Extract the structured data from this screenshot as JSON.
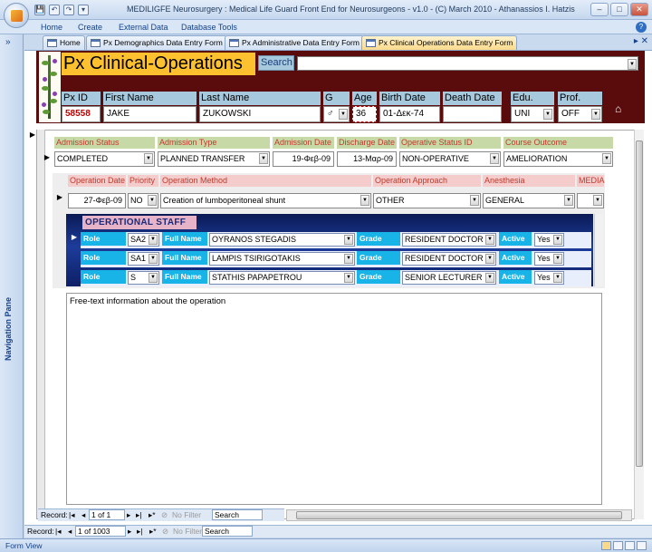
{
  "app": {
    "title": "MEDILIGFE Neurosurgery : Medical Life Guard Front End for Neurosurgeons - v1.0 - (C) March 2010 - Athanassios I. Hatzis",
    "window_buttons": [
      "–",
      "□",
      "✕"
    ],
    "help": "?"
  },
  "quick_access": {
    "save": "💾",
    "undo": "↶",
    "redo": "↷",
    "customize": "▾"
  },
  "ribbon_tabs": [
    "Home",
    "Create",
    "External Data",
    "Database Tools"
  ],
  "nav_pane": {
    "label": "Navigation Pane",
    "toggle": "»"
  },
  "doc_tabs": [
    {
      "label": "Home",
      "active": false
    },
    {
      "label": "Px Demographics Data Entry Form",
      "active": false
    },
    {
      "label": "Px Administrative Data Entry Form",
      "active": false
    },
    {
      "label": "Px Clinical Operations Data Entry Form",
      "active": true
    }
  ],
  "doc_tab_controls": "▸ ✕",
  "header": {
    "form_title": "Px Clinical-Operations",
    "search_label": "Search",
    "search_value": "",
    "fields": {
      "px_id": {
        "label": "Px ID",
        "value": "58558"
      },
      "first_name": {
        "label": "First Name",
        "value": "JAKE"
      },
      "last_name": {
        "label": "Last Name",
        "value": "ZUKOWSKI"
      },
      "gender": {
        "label": "G",
        "value": "♂"
      },
      "age": {
        "label": "Age",
        "value": "36"
      },
      "birth_date": {
        "label": "Birth Date",
        "value": "01-Δεκ-74"
      },
      "death_date": {
        "label": "Death Date",
        "value": ""
      },
      "education": {
        "label": "Edu.",
        "value": "UNI"
      },
      "profession": {
        "label": "Prof.",
        "value": "OFF"
      }
    },
    "home_icon": "⌂"
  },
  "admission": {
    "labels": {
      "status": "Admission Status",
      "type": "Admission Type",
      "date": "Admission Date",
      "discharge": "Discharge Date",
      "op_status": "Operative Status ID",
      "outcome": "Course Outcome"
    },
    "values": {
      "status": "COMPLETED",
      "type": "PLANNED TRANSFER",
      "date": "19-Φεβ-09",
      "discharge": "13-Μαρ-09",
      "op_status": "NON-OPERATIVE",
      "outcome": "AMELIORATION"
    }
  },
  "operation": {
    "labels": {
      "date": "Operation Date",
      "priority": "Priority",
      "method": "Operation Method",
      "approach": "Operation Approach",
      "anesthesia": "Anesthesia",
      "media": "MEDIA"
    },
    "values": {
      "date": "27-Φεβ-09",
      "priority": "NO",
      "method": "Creation of lumboperitoneal shunt",
      "approach": "OTHER",
      "anesthesia": "GENERAL",
      "media": ""
    }
  },
  "staff": {
    "title": "OPERATIONAL STAFF",
    "labels": {
      "role": "Role",
      "full_name": "Full Name",
      "grade": "Grade",
      "active": "Active"
    },
    "rows": [
      {
        "role": "SA2",
        "full_name": "OYRANOS STEGADIS",
        "grade": "RESIDENT DOCTOR",
        "active": "Yes"
      },
      {
        "role": "SA1",
        "full_name": "LAMPIS TSIRIGOTAKIS",
        "grade": "RESIDENT DOCTOR",
        "active": "Yes"
      },
      {
        "role": "S",
        "full_name": "STATHIS PAPAPETROU",
        "grade": "SENIOR LECTURER",
        "active": "Yes"
      }
    ]
  },
  "memo": {
    "text": "Free-text information about the operation"
  },
  "subform_record_nav": {
    "label": "Record:",
    "position": "1 of 1",
    "filter": "No Filter",
    "search": "Search"
  },
  "main_record_nav": {
    "label": "Record:",
    "position": "1 of 1003",
    "filter": "No Filter",
    "search": "Search"
  },
  "status_bar": {
    "view": "Form View"
  },
  "colors": {
    "header_band": "#5a0c0c",
    "title_bg": "#fdc02f",
    "label_bg": "#a7c9dd",
    "staff_label": "#18b4e8",
    "staff_title": "#e6b3c8",
    "px_id_value": "#c00000"
  }
}
